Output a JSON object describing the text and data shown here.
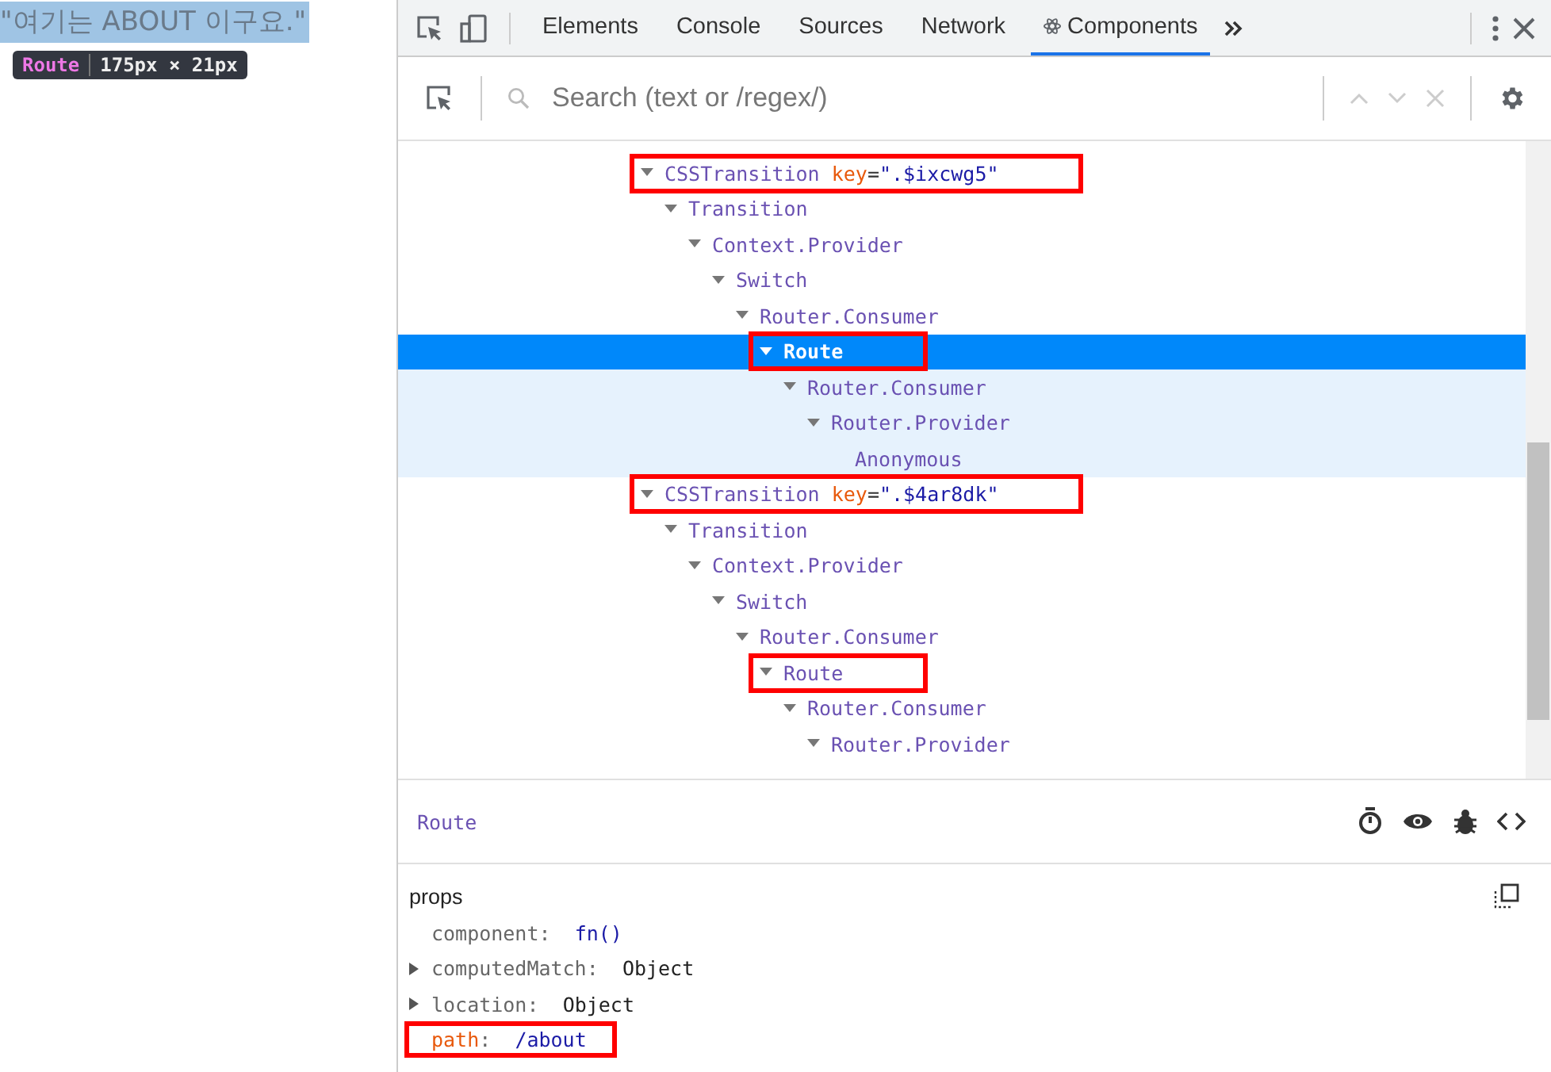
{
  "page": {
    "text": "\"여기는 ABOUT 이구요.\"",
    "tooltip": {
      "name": "Route",
      "size": "175px × 21px"
    }
  },
  "tabs": [
    {
      "label": "Elements",
      "selected": false,
      "icon": false
    },
    {
      "label": "Console",
      "selected": false,
      "icon": false
    },
    {
      "label": "Sources",
      "selected": false,
      "icon": false
    },
    {
      "label": "Network",
      "selected": false,
      "icon": false
    },
    {
      "label": "Components",
      "selected": true,
      "icon": true
    }
  ],
  "search": {
    "placeholder": "Search (text or /regex/)"
  },
  "tree": [
    {
      "name": "CSSTransition",
      "attr": {
        "name": "key",
        "sep": "=",
        "value": "\".$ixcwg5\""
      },
      "expanded": true,
      "selected": false,
      "boxed": true,
      "children": [
        {
          "name": "Transition",
          "expanded": true,
          "selected": false,
          "boxed": false,
          "children": [
            {
              "name": "Context.Provider",
              "expanded": true,
              "selected": false,
              "boxed": false,
              "children": [
                {
                  "name": "Switch",
                  "expanded": true,
                  "selected": false,
                  "boxed": false,
                  "children": [
                    {
                      "name": "Router.Consumer",
                      "expanded": true,
                      "selected": false,
                      "boxed": false,
                      "children": [
                        {
                          "name": "Route",
                          "expanded": true,
                          "selected": true,
                          "boxed": true,
                          "children": [
                            {
                              "name": "Router.Consumer",
                              "expanded": true,
                              "selected": false,
                              "boxed": false,
                              "children": [
                                {
                                  "name": "Router.Provider",
                                  "expanded": true,
                                  "selected": false,
                                  "boxed": false,
                                  "children": [
                                    {
                                      "name": "Anonymous",
                                      "expanded": false,
                                      "selected": false,
                                      "boxed": false
                                    }
                                  ]
                                }
                              ]
                            }
                          ]
                        }
                      ]
                    }
                  ]
                }
              ]
            }
          ]
        }
      ]
    },
    {
      "name": "CSSTransition",
      "attr": {
        "name": "key",
        "sep": "=",
        "value": "\".$4ar8dk\""
      },
      "expanded": true,
      "selected": false,
      "boxed": true,
      "children": [
        {
          "name": "Transition",
          "expanded": true,
          "selected": false,
          "boxed": false,
          "children": [
            {
              "name": "Context.Provider",
              "expanded": true,
              "selected": false,
              "boxed": false,
              "children": [
                {
                  "name": "Switch",
                  "expanded": true,
                  "selected": false,
                  "boxed": false,
                  "children": [
                    {
                      "name": "Router.Consumer",
                      "expanded": true,
                      "selected": false,
                      "boxed": false,
                      "children": [
                        {
                          "name": "Route",
                          "expanded": true,
                          "selected": false,
                          "boxed": true,
                          "children": [
                            {
                              "name": "Router.Consumer",
                              "expanded": true,
                              "selected": false,
                              "boxed": false,
                              "children": [
                                {
                                  "name": "Router.Provider",
                                  "expanded": true,
                                  "selected": false,
                                  "boxed": false
                                }
                              ]
                            }
                          ]
                        }
                      ]
                    }
                  ]
                }
              ]
            }
          ]
        }
      ]
    }
  ],
  "details": {
    "title": "Route",
    "section": "props",
    "props": [
      {
        "name": "component",
        "sep": ":",
        "value": "fn()",
        "kind": "function",
        "expandable": false,
        "boxed": false
      },
      {
        "name": "computedMatch",
        "sep": ":",
        "value": "Object",
        "kind": "object",
        "expandable": true,
        "boxed": false
      },
      {
        "name": "location",
        "sep": ":",
        "value": "Object",
        "kind": "object",
        "expandable": true,
        "boxed": false
      },
      {
        "name": "path",
        "sep": ":",
        "value": "/about",
        "kind": "string",
        "expandable": false,
        "boxed": true
      }
    ]
  }
}
